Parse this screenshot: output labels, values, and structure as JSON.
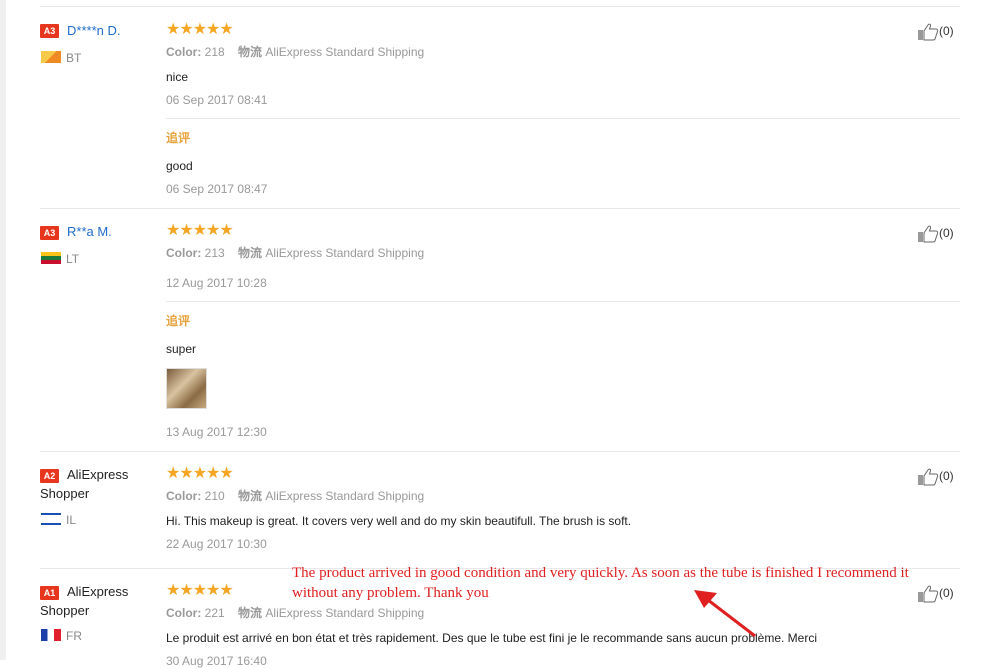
{
  "reviews": [
    {
      "badge": "A3",
      "user": "D****n D.",
      "country": "BT",
      "color_label": "Color:",
      "color_value": "218",
      "logistics_label": "物流",
      "logistics_value": "AliExpress Standard Shipping",
      "text": "nice",
      "date": "06 Sep 2017 08:41",
      "additional_label": "追评",
      "additional_text": "good",
      "additional_date": "06 Sep 2017 08:47",
      "likes": "(0)",
      "rating": 5
    },
    {
      "badge": "A3",
      "user": "R**a M.",
      "country": "LT",
      "color_label": "Color:",
      "color_value": "213",
      "logistics_label": "物流",
      "logistics_value": "AliExpress Standard Shipping",
      "date": "12 Aug 2017 10:28",
      "additional_label": "追评",
      "additional_text": "super",
      "additional_date": "13 Aug 2017 12:30",
      "likes": "(0)",
      "rating": 5
    },
    {
      "badge": "A2",
      "user": "AliExpress Shopper",
      "country": "IL",
      "color_label": "Color:",
      "color_value": "210",
      "logistics_label": "物流",
      "logistics_value": "AliExpress Standard Shipping",
      "text": "Hi. This makeup is great. It covers very well and do my skin beautifull. The brush is soft.",
      "date": "22 Aug 2017 10:30",
      "likes": "(0)",
      "rating": 5
    },
    {
      "badge": "A1",
      "user": "AliExpress Shopper",
      "country": "FR",
      "color_label": "Color:",
      "color_value": "221",
      "logistics_label": "物流",
      "logistics_value": "AliExpress Standard Shipping",
      "text": "Le produit est arrivé en bon état et très rapidement. Des que le tube est fini je le recommande sans aucun problème. Merci",
      "date": "30 Aug 2017 16:40",
      "likes": "(0)",
      "rating": 5
    }
  ],
  "annotation": "The product arrived in good condition and very quickly. As soon as the tube is finished I recommend it without any problem. Thank you",
  "colors": {
    "star": "#f5a623",
    "link": "#1f6ccc",
    "badge": "#e6361d",
    "annotation": "#e02020",
    "additional": "#e6a23c"
  },
  "icons": {
    "like": "thumbs-up-icon",
    "star": "star-icon"
  }
}
